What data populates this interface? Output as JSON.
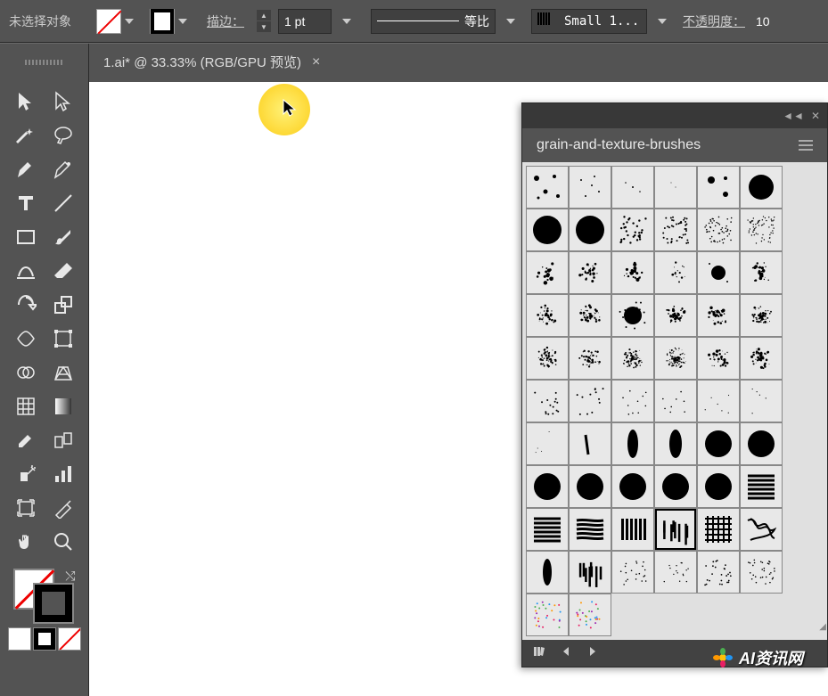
{
  "topbar": {
    "no_selection": "未选择对象",
    "stroke_label": "描边：",
    "stroke_weight": "1 pt",
    "profile_label": "等比",
    "brush_preset": "Small 1...",
    "opacity_label": "不透明度：",
    "opacity_value": "10"
  },
  "tab": {
    "title": "1.ai* @ 33.33% (RGB/GPU 预览)",
    "close": "×"
  },
  "panel": {
    "title": "grain-and-texture-brushes"
  },
  "watermark": {
    "text": "AI资讯网"
  }
}
